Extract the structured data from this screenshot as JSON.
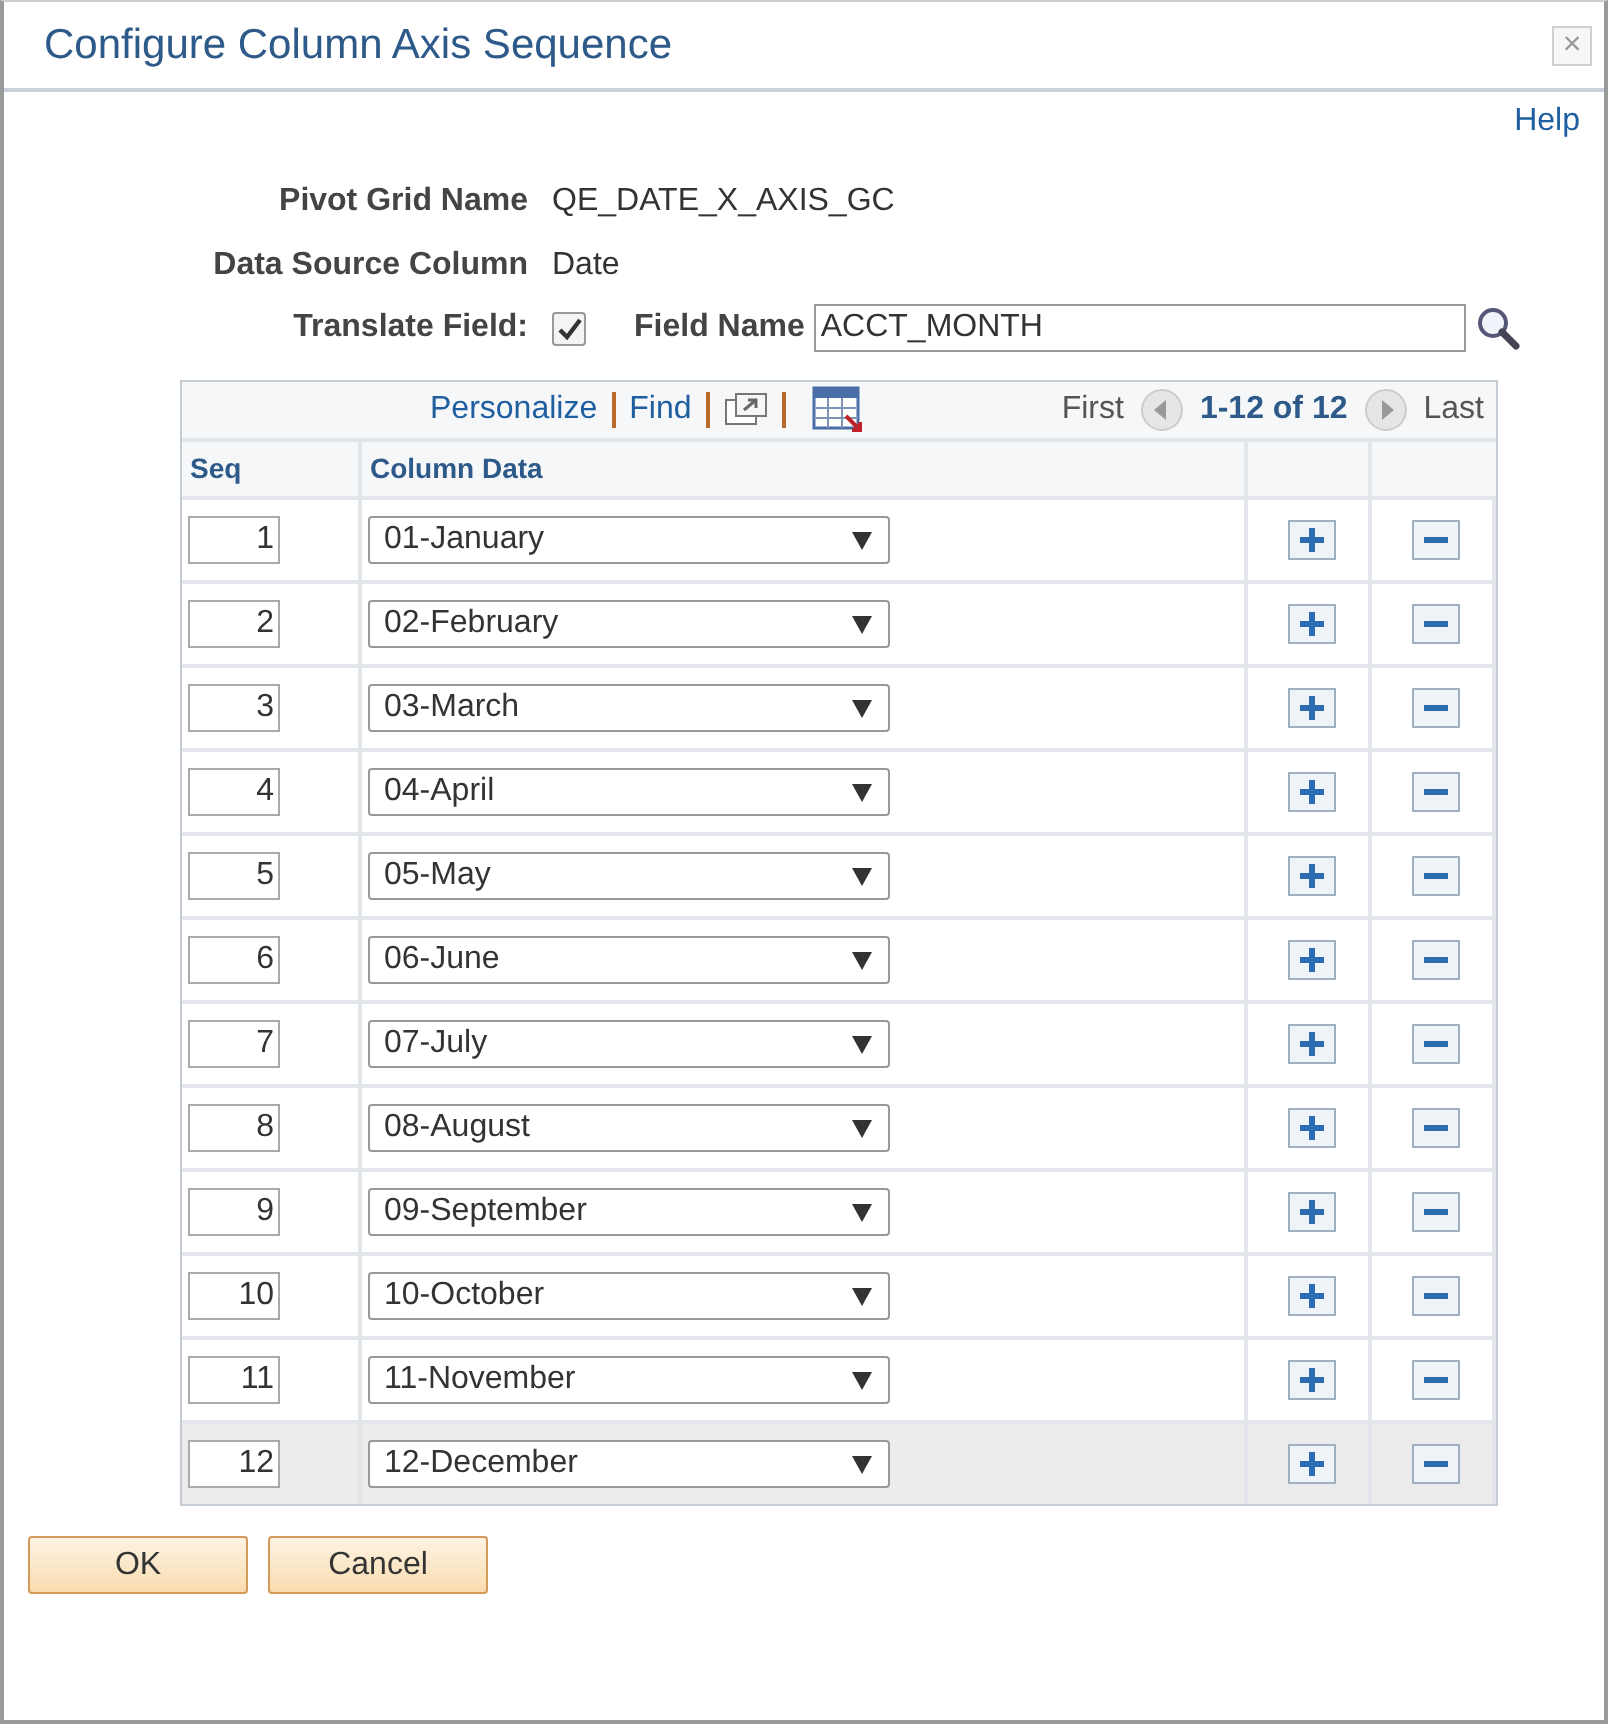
{
  "window": {
    "title": "Configure Column Axis Sequence",
    "close": "×"
  },
  "help": "Help",
  "fields": [
    {
      "label": "Pivot Grid Name",
      "value": "QE_DATE_X_AXIS_GC"
    },
    {
      "label": "Data Source Column",
      "value": "Date"
    }
  ],
  "translate": {
    "label": "Translate Field:",
    "checked": true
  },
  "field_name": {
    "label": "Field Name",
    "value": "ACCT_MONTH"
  },
  "grid": {
    "toolbar": {
      "personalize": "Personalize",
      "find": "Find",
      "first": "First",
      "range": "1-12 of 12",
      "last": "Last"
    },
    "columns": [
      "Seq",
      "Column Data"
    ],
    "rows": [
      {
        "seq": "1",
        "data": "01-January",
        "highlighted": false
      },
      {
        "seq": "2",
        "data": "02-February",
        "highlighted": false
      },
      {
        "seq": "3",
        "data": "03-March",
        "highlighted": false
      },
      {
        "seq": "4",
        "data": "04-April",
        "highlighted": false
      },
      {
        "seq": "5",
        "data": "05-May",
        "highlighted": false
      },
      {
        "seq": "6",
        "data": "06-June",
        "highlighted": false
      },
      {
        "seq": "7",
        "data": "07-July",
        "highlighted": false
      },
      {
        "seq": "8",
        "data": "08-August",
        "highlighted": false
      },
      {
        "seq": "9",
        "data": "09-September",
        "highlighted": false
      },
      {
        "seq": "10",
        "data": "10-October",
        "highlighted": false
      },
      {
        "seq": "11",
        "data": "11-November",
        "highlighted": false
      },
      {
        "seq": "12",
        "data": "12-December",
        "highlighted": true
      }
    ]
  },
  "buttons": [
    "OK",
    "Cancel"
  ]
}
